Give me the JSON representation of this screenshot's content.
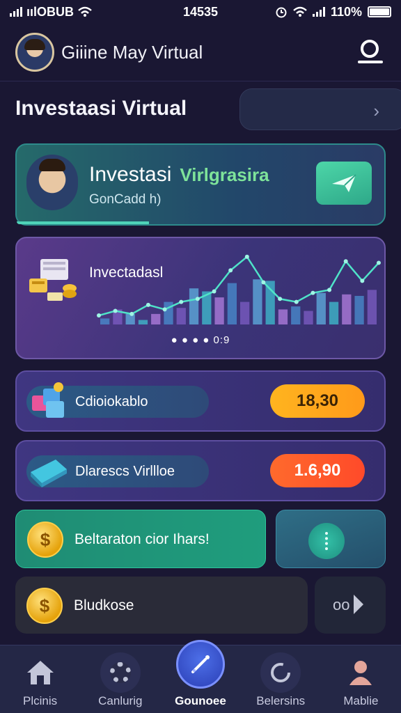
{
  "status_bar": {
    "carrier": "ıılOBUB",
    "time": "14535",
    "battery": "110%"
  },
  "header": {
    "title": "Giiine May Virtual"
  },
  "section": {
    "title": "Investaasi Virtual",
    "next_icon": "chevron-right-icon"
  },
  "hero": {
    "title": "Investasi",
    "accent": "Virlgrasira",
    "subtitle": "GonCadd h)",
    "progress_fraction": 0.36,
    "action_icon": "send-icon"
  },
  "chart_card": {
    "title": "Invectadasl",
    "indicator": "● ●  ● ● 0:9",
    "chart_data": {
      "type": "bar",
      "title": "Invectadasl",
      "bars": [
        8,
        20,
        14,
        6,
        14,
        30,
        22,
        48,
        44,
        36,
        55,
        30,
        60,
        58,
        20,
        24,
        18,
        42,
        30,
        40,
        38,
        46
      ],
      "line": [
        12,
        18,
        14,
        26,
        20,
        30,
        34,
        44,
        72,
        90,
        56,
        34,
        30,
        42,
        46,
        84,
        58,
        82
      ],
      "ylim": [
        0,
        100
      ]
    }
  },
  "rows": [
    {
      "label": "Cdioiokablo",
      "value": "18,30",
      "icon": "blocks-icon"
    },
    {
      "label": "Dlarescs Virllloe",
      "value": "1.6,90",
      "icon": "ticket-icon"
    }
  ],
  "promo": {
    "label": "Beltaraton cior Ihars!",
    "coin": "$"
  },
  "promo_side": {
    "icon": "info-icon"
  },
  "balance": {
    "label": "Bludkose",
    "coin": "$",
    "side_text": "oo"
  },
  "nav": [
    {
      "label": "Plcinis",
      "icon": "home-icon"
    },
    {
      "label": "Canlurig",
      "icon": "gear-icon"
    },
    {
      "label": "Gounoee",
      "icon": "pen-icon",
      "active": true
    },
    {
      "label": "Belersins",
      "icon": "refresh-icon"
    },
    {
      "label": "Mablie",
      "icon": "profile-icon"
    }
  ]
}
